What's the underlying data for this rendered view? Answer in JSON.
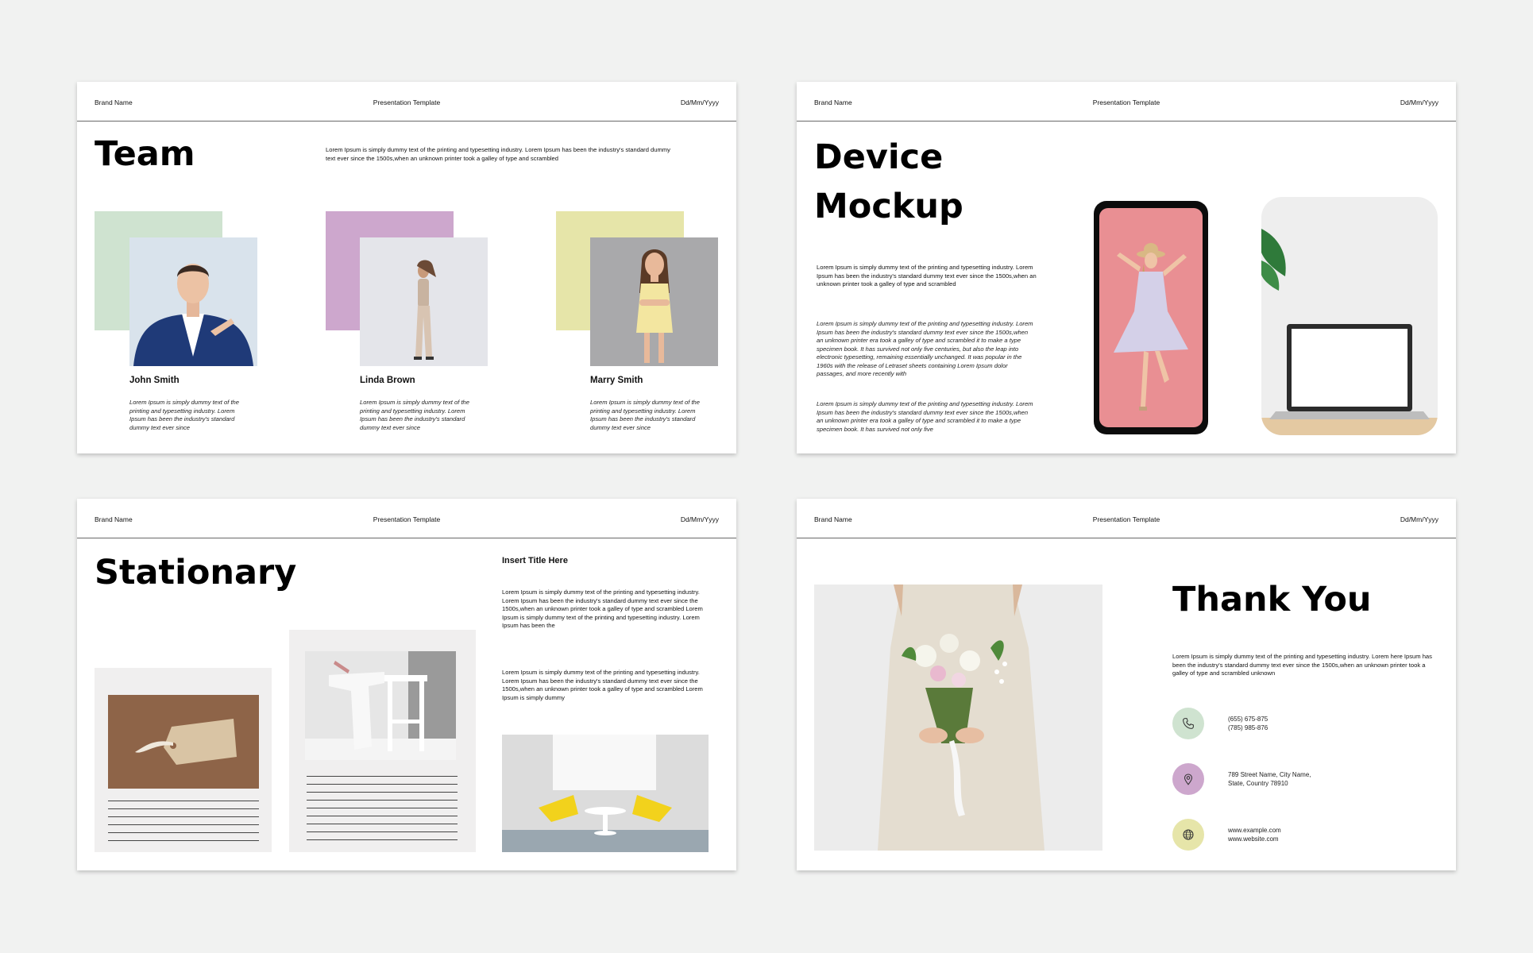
{
  "header": {
    "brand": "Brand Name",
    "template": "Presentation Template",
    "date": "Dd/Mm/Yyyy"
  },
  "colors": {
    "green": "#cfe3d0",
    "purple": "#cda7cd",
    "yellow": "#e6e5a9"
  },
  "team": {
    "title": "Team",
    "intro": "Lorem Ipsum is simply dummy text of the printing and typesetting industry. Lorem Ipsum has been the industry's standard dummy text ever since the 1500s,when an unknown printer took a galley of type and scrambled",
    "members": [
      {
        "name": "John Smith",
        "bio": "Lorem Ipsum is simply dummy text of the printing and typesetting industry. Lorem Ipsum has been the industry's standard dummy text ever since"
      },
      {
        "name": "Linda Brown",
        "bio": "Lorem Ipsum is simply dummy text of the printing and typesetting industry. Lorem Ipsum has been the industry's standard dummy text ever since"
      },
      {
        "name": "Marry Smith",
        "bio": "Lorem Ipsum is simply dummy text of the printing and typesetting industry. Lorem Ipsum has been the industry's standard dummy text ever since"
      }
    ]
  },
  "device": {
    "title_line1": "Device",
    "title_line2": "Mockup",
    "intro": "Lorem Ipsum is simply dummy text of the printing and typesetting industry. Lorem Ipsum has been the industry's standard dummy text ever since the 1500s,when an unknown printer took a galley of type and scrambled",
    "body1": "Lorem Ipsum is simply dummy text of the printing and typesetting industry. Lorem Ipsum has been the industry's standard dummy text ever since the 1500s,when an unknown printer era took a galley of type and scrambled it to make a type specimen book. It has survived not only five centuries, but also the leap into electronic typesetting, remaining essentially unchanged. It was popular in the 1960s with the release of Letraset sheets containing Lorem Ipsum dolor passages, and more recently with",
    "body2": "Lorem Ipsum is simply dummy text of the printing and typesetting industry. Lorem Ipsum has been the industry's standard dummy text ever since the 1500s,when an unknown printer era took a galley of type and scrambled it to make a type specimen book. It has survived not only five"
  },
  "stationary": {
    "title": "Stationary",
    "subtitle": "Insert Title Here",
    "para1": "Lorem Ipsum is simply dummy text of the printing and typesetting industry. Lorem Ipsum has been the industry's standard dummy text ever since the 1500s,when an unknown printer took a galley of type and scrambled Lorem Ipsum is simply dummy text of the printing and typesetting industry. Lorem Ipsum has been the",
    "para2": "Lorem Ipsum is simply dummy text of the printing and typesetting industry. Lorem Ipsum has been the industry's standard dummy text ever since the 1500s,when an unknown printer took a galley of type and scrambled Lorem Ipsum is simply dummy"
  },
  "thanks": {
    "title": "Thank You",
    "intro": "Lorem Ipsum is simply dummy text of the printing and typesetting industry. Lorem here Ipsum has been the industry's standard dummy text ever since the 1500s,when an unknown printer took a galley of type and scrambled unknown",
    "contacts": [
      {
        "icon": "phone-icon",
        "line1": "(655) 675-875",
        "line2": "(785) 985-876"
      },
      {
        "icon": "location-pin-icon",
        "line1": "789 Street Name, City Name,",
        "line2": "State, Country 78910"
      },
      {
        "icon": "globe-icon",
        "line1": "www.example.com",
        "line2": "www.website.com"
      }
    ]
  }
}
